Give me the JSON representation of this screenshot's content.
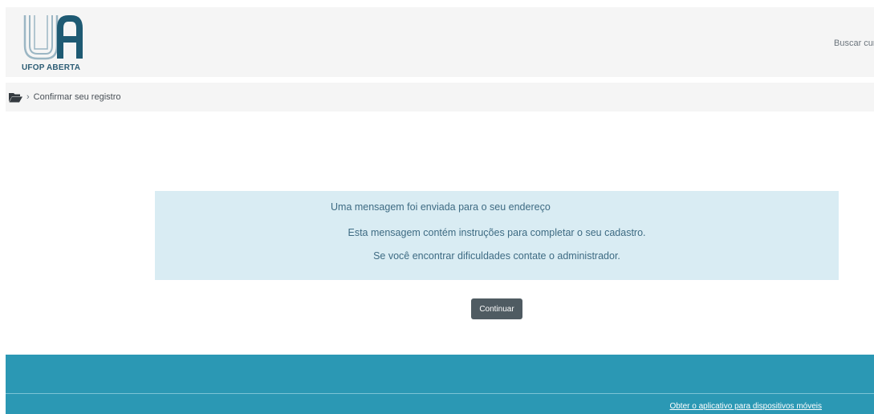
{
  "header": {
    "logo_text": "UFOP ABERTA",
    "search_placeholder": "Buscar cur"
  },
  "breadcrumb": {
    "home_icon": "folder-open-icon",
    "separator": "›",
    "current": "Confirmar seu registro"
  },
  "notice": {
    "line1": "Uma mensagem foi enviada para o seu endereço",
    "line2": "Esta mensagem contém instruções para completar o seu cadastro.",
    "line3": "Se você encontrar dificuldades contate o administrador."
  },
  "actions": {
    "continue_label": "Continuar"
  },
  "footer": {
    "mobile_app_link": "Obter o aplicativo para dispositivos móveis"
  },
  "colors": {
    "header_bg": "#f5f5f5",
    "notice_bg": "#d9ecf3",
    "notice_text": "#3e6b83",
    "button_bg": "#4f5b62",
    "footer_bg": "#2b98b4"
  }
}
